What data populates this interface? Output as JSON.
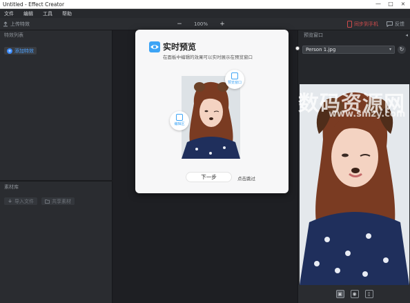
{
  "window": {
    "title": "Untitled - Effect Creator",
    "min": "—",
    "max": "□",
    "close": "×"
  },
  "menu": [
    "文件",
    "编辑",
    "工具",
    "帮助"
  ],
  "toolbar": {
    "upload_label": "上传特效",
    "zoom_minus": "−",
    "zoom_value": "100%",
    "zoom_plus": "+",
    "sync_label": "同步到手机",
    "feedback_label": "反馈"
  },
  "left_panel": {
    "effects_title": "特效列表",
    "add_effect_label": "添加特效",
    "materials_title": "素材库",
    "import_label": "导入文件",
    "shared_label": "共享素材"
  },
  "right_panel": {
    "title": "预览窗口",
    "collapse_icon": "◂",
    "selected_image": "Person 1.jpg",
    "dropdown_arrow": "▾",
    "refresh_icon": "↻"
  },
  "watermark": {
    "main": "数码资源网",
    "sub": "www.smzy.com"
  },
  "dialog": {
    "title": "实时预览",
    "description": "在面板中编辑的效果可以实时展示在预览窗口",
    "bubble_top": "预览窗口",
    "bubble_left": "编辑区",
    "next_label": "下一步",
    "skip_label": "点击跳过"
  },
  "colors": {
    "accent_blue": "#3da4f5",
    "sync_red": "#d24c4c",
    "panel_bg": "#2a2c30"
  }
}
